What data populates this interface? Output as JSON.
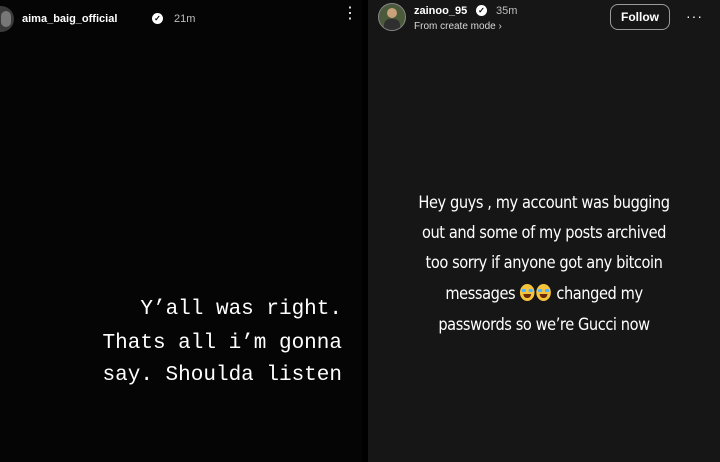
{
  "left_story": {
    "username": "aima_baig_official",
    "time": "21m",
    "lines": [
      "Y’all was right.",
      "Thats all i’m gonna",
      "say. Shoulda listen"
    ]
  },
  "right_story": {
    "username": "zainoo_95",
    "time": "35m",
    "subtitle": "From create mode ›",
    "follow_label": "Follow",
    "more_label": "···",
    "lines": [
      "Hey guys , my account was bugging",
      "out and some of my posts archived",
      "too sorry if anyone got any bitcoin"
    ],
    "line4_before": "messages",
    "line4_after": "changed my",
    "line5": "passwords so we’re Gucci now"
  },
  "icons": {
    "verified": "verified-badge-icon",
    "more_vertical": "more-vertical-icon",
    "emoji": "face-with-tears-of-joy-icon"
  },
  "colors": {
    "left_bg": "#050505",
    "right_bg": "#161616",
    "text": "#ffffff"
  }
}
